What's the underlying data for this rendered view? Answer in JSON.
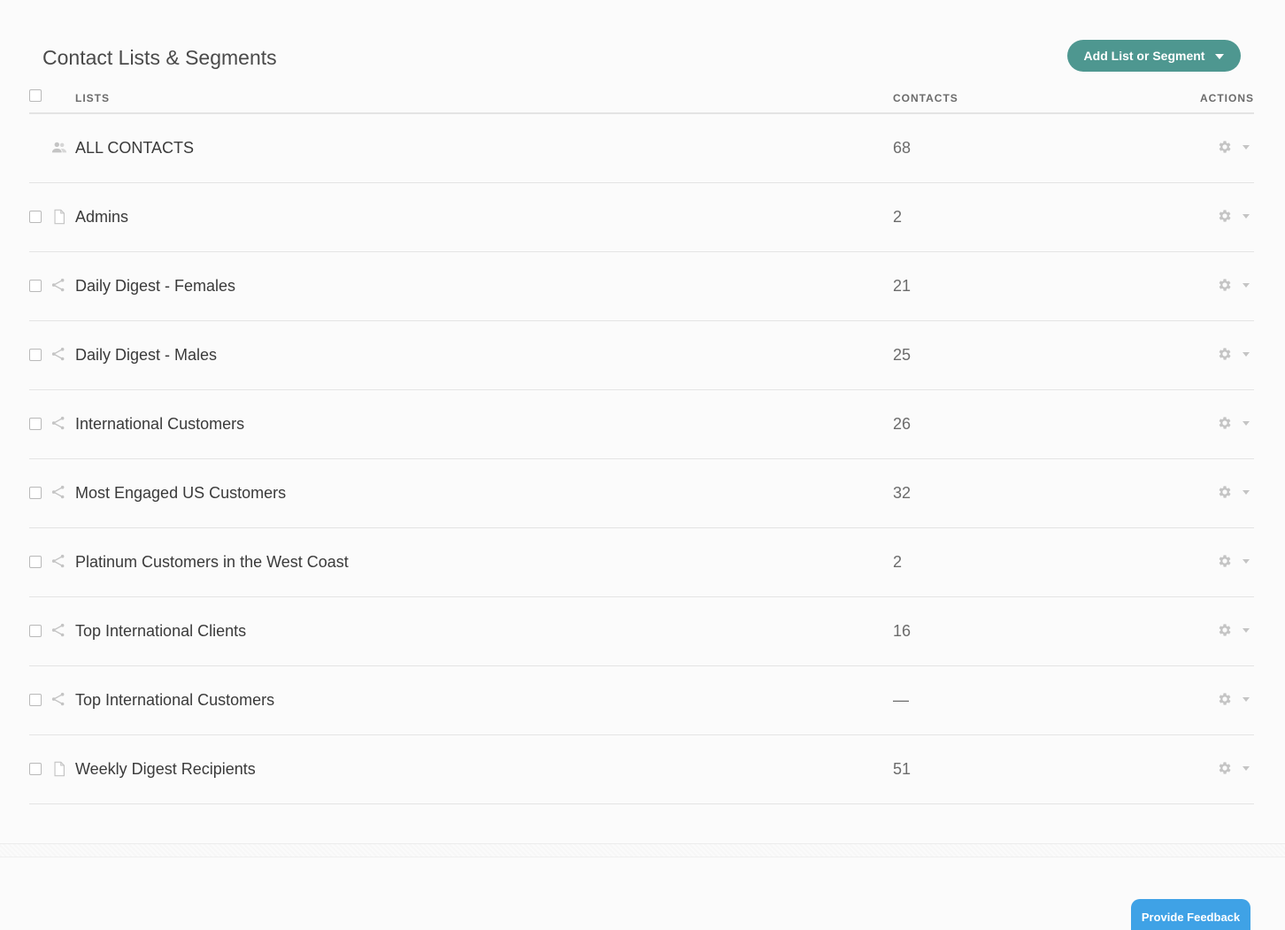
{
  "header": {
    "title": "Contact Lists & Segments",
    "add_button_label": "Add List or Segment"
  },
  "table": {
    "columns": {
      "lists": "LISTS",
      "contacts": "CONTACTS",
      "actions": "ACTIONS"
    },
    "rows": [
      {
        "name": "ALL CONTACTS",
        "count": "68",
        "type": "all-contacts",
        "icon": "people-icon",
        "selectable": false
      },
      {
        "name": "Admins",
        "count": "2",
        "type": "list",
        "icon": "document-icon",
        "selectable": true
      },
      {
        "name": "Daily Digest - Females",
        "count": "21",
        "type": "segment",
        "icon": "segment-icon",
        "selectable": true
      },
      {
        "name": "Daily Digest - Males",
        "count": "25",
        "type": "segment",
        "icon": "segment-icon",
        "selectable": true
      },
      {
        "name": "International Customers",
        "count": "26",
        "type": "segment",
        "icon": "segment-icon",
        "selectable": true
      },
      {
        "name": "Most Engaged US Customers",
        "count": "32",
        "type": "segment",
        "icon": "segment-icon",
        "selectable": true
      },
      {
        "name": "Platinum Customers in the West Coast",
        "count": "2",
        "type": "segment",
        "icon": "segment-icon",
        "selectable": true
      },
      {
        "name": "Top International Clients",
        "count": "16",
        "type": "segment",
        "icon": "segment-icon",
        "selectable": true
      },
      {
        "name": "Top International Customers",
        "count": "—",
        "type": "segment",
        "icon": "segment-icon",
        "selectable": true
      },
      {
        "name": "Weekly Digest Recipients",
        "count": "51",
        "type": "list",
        "icon": "document-icon",
        "selectable": true
      }
    ]
  },
  "footer": {
    "feedback_label": "Provide Feedback"
  },
  "colors": {
    "accent": "#4e9790",
    "feedback": "#3fa2e6",
    "icon": "#c4c4c4"
  }
}
